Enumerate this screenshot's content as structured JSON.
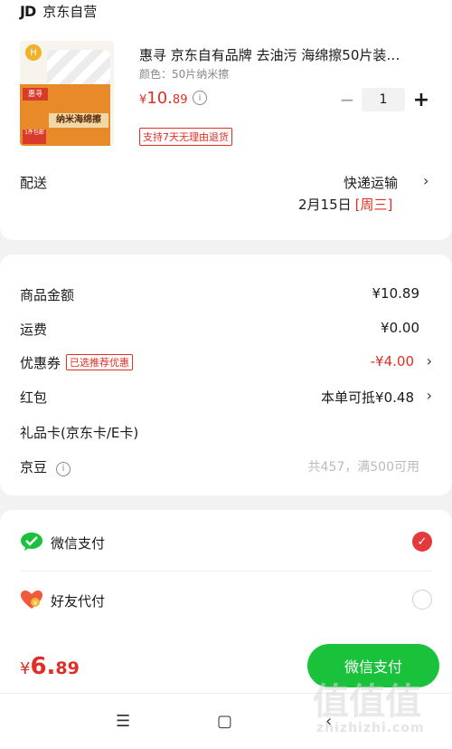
{
  "store": {
    "logo_text": "JD",
    "name": "京东自营"
  },
  "product": {
    "title": "惠寻 京东自有品牌 去油污 海绵擦50片装…",
    "variant": "颜色：50片纳米擦",
    "price_yen": "¥",
    "price_int": "10.",
    "price_dec": "89",
    "quantity": "1",
    "minus_label": "−",
    "plus_label": "+",
    "return_badge": "支持7天无理由退货",
    "thumb": {
      "brand_mark": "H",
      "tag_brand": "惠寻",
      "box_label": "纳米海绵擦",
      "piece_label": "1件包邮"
    }
  },
  "shipping": {
    "label": "配送",
    "method": "快递运输",
    "date": "2月15日",
    "weekday": "[周三]"
  },
  "summary": {
    "goods_label": "商品金额",
    "goods_value": "¥10.89",
    "freight_label": "运费",
    "freight_value": "¥0.00",
    "coupon_label": "优惠券",
    "coupon_badge": "已选推荐优惠",
    "coupon_value": "-¥4.00",
    "redpacket_label": "红包",
    "redpacket_value": "本单可抵¥0.48",
    "giftcard_label": "礼品卡(京东卡/E卡)",
    "beans_label": "京豆",
    "beans_value": "共457，满500可用"
  },
  "payment": {
    "wechat_label": "微信支付",
    "friend_label": "好友代付",
    "selected": "wechat"
  },
  "footer": {
    "total_yen": "¥",
    "total_int": "6.",
    "total_dec": "89",
    "pay_button": "微信支付"
  },
  "navbar": {
    "menu": "☰",
    "home": "▢",
    "back": "‹"
  },
  "watermark": {
    "glyphs": "值值值",
    "text": "zhizhizhi.com"
  },
  "colors": {
    "accent_red": "#e02e24",
    "wechat_green": "#19c23a"
  }
}
